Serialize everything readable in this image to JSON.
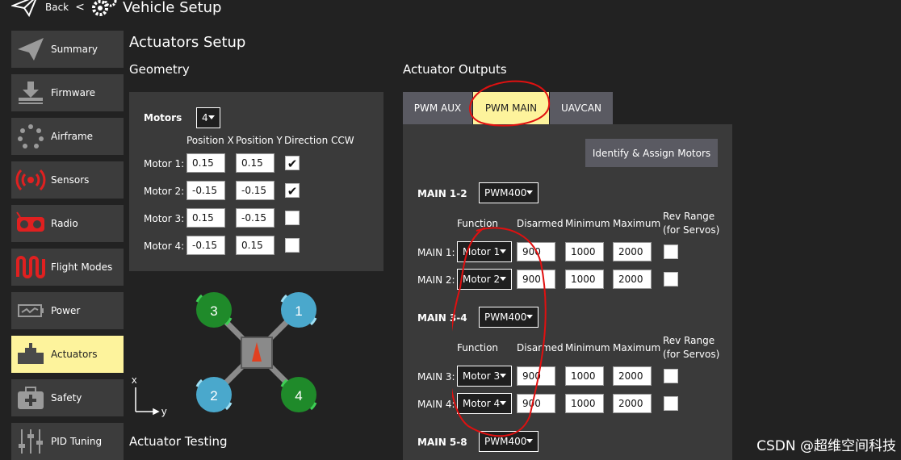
{
  "header": {
    "back_label": "Back",
    "separator": "<",
    "title": "Vehicle Setup"
  },
  "sidebar": {
    "items": [
      {
        "label": "Summary",
        "icon": "paper-plane-icon"
      },
      {
        "label": "Firmware",
        "icon": "download-icon"
      },
      {
        "label": "Airframe",
        "icon": "dots-circle-icon"
      },
      {
        "label": "Sensors",
        "icon": "radio-waves-icon"
      },
      {
        "label": "Radio",
        "icon": "remote-control-icon"
      },
      {
        "label": "Flight Modes",
        "icon": "waveform-icon"
      },
      {
        "label": "Power",
        "icon": "battery-icon"
      },
      {
        "label": "Actuators",
        "icon": "actuator-icon",
        "active": true
      },
      {
        "label": "Safety",
        "icon": "medkit-icon"
      },
      {
        "label": "PID Tuning",
        "icon": "sliders-icon"
      }
    ]
  },
  "main": {
    "title": "Actuators Setup",
    "geometry": {
      "heading": "Geometry",
      "motors_label": "Motors",
      "motors_value": "4",
      "columns": [
        "Position X",
        "Position Y",
        "Direction CCW"
      ],
      "rows": [
        {
          "label": "Motor 1:",
          "x": "0.15",
          "y": "0.15",
          "ccw": true
        },
        {
          "label": "Motor 2:",
          "x": "-0.15",
          "y": "-0.15",
          "ccw": true
        },
        {
          "label": "Motor 3:",
          "x": "0.15",
          "y": "-0.15",
          "ccw": false
        },
        {
          "label": "Motor 4:",
          "x": "-0.15",
          "y": "0.15",
          "ccw": false
        }
      ]
    },
    "diagram": {
      "motors": [
        "1",
        "2",
        "3",
        "4"
      ],
      "axis_x": "x",
      "axis_y": "y"
    },
    "testing_heading": "Actuator Testing",
    "outputs": {
      "heading": "Actuator Outputs",
      "tabs": [
        "PWM AUX",
        "PWM MAIN",
        "UAVCAN"
      ],
      "active_tab": "PWM MAIN",
      "identify_button": "Identify & Assign Motors",
      "columns": [
        "Function",
        "Disarmed",
        "Minimum",
        "Maximum",
        "Rev Range",
        "(for Servos)"
      ],
      "groups": [
        {
          "label": "MAIN 1-2",
          "rate": "PWM400",
          "rows": [
            {
              "label": "MAIN 1:",
              "function": "Motor 1",
              "disarmed": "900",
              "min": "1000",
              "max": "2000"
            },
            {
              "label": "MAIN 2:",
              "function": "Motor 2",
              "disarmed": "900",
              "min": "1000",
              "max": "2000"
            }
          ]
        },
        {
          "label": "MAIN 3-4",
          "rate": "PWM400",
          "rows": [
            {
              "label": "MAIN 3:",
              "function": "Motor 3",
              "disarmed": "900",
              "min": "1000",
              "max": "2000"
            },
            {
              "label": "MAIN 4:",
              "function": "Motor 4",
              "disarmed": "900",
              "min": "1000",
              "max": "2000"
            }
          ]
        },
        {
          "label": "MAIN 5-8",
          "rate": "PWM400",
          "rows": []
        }
      ]
    }
  },
  "watermark": "CSDN @超维空间科技",
  "colors": {
    "active": "#fdf39c",
    "panel": "#3a3a3a",
    "motor_cw": "#1f8a2a",
    "motor_ccw": "#4aa8cc",
    "annotation": "#e01010"
  }
}
